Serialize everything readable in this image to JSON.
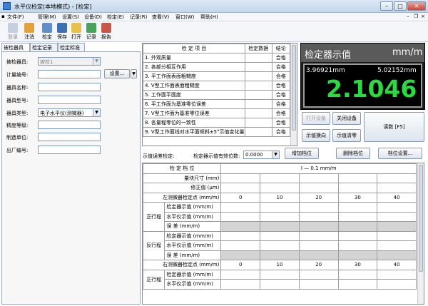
{
  "window": {
    "title": "水平仪检定(本地模式) - [检定]"
  },
  "menu": [
    "文件(F)",
    "管理(M)",
    "设置(S)",
    "设备(D)",
    "检定(E)",
    "记录(R)",
    "查看(V)",
    "窗口(W)",
    "帮助(H)"
  ],
  "toolbar": [
    {
      "label": "登录",
      "icon": "login-icon",
      "disabled": true
    },
    {
      "label": "注消",
      "icon": "logout-icon",
      "disabled": false
    },
    {
      "label": "检定",
      "icon": "verify-icon",
      "disabled": false
    },
    {
      "label": "保存",
      "icon": "save-icon",
      "disabled": false
    },
    {
      "label": "打开",
      "icon": "open-folder-icon",
      "disabled": false
    },
    {
      "label": "记录",
      "icon": "record-icon",
      "disabled": false
    },
    {
      "label": "报告",
      "icon": "report-icon",
      "disabled": false
    }
  ],
  "left_tabs": [
    "被检器具",
    "检定记录",
    "检定标准"
  ],
  "form": {
    "instrument_label": "被检器具:",
    "instrument_value": "被检1",
    "meter_no_label": "计量编号:",
    "settings_button": "设置...",
    "name_label": "器具名称:",
    "model_label": "器具型号:",
    "type_label": "器具类型:",
    "type_value": "电子水平仪(测微器)",
    "accuracy_label": "精度等级:",
    "maker_label": "制造单位:",
    "serial_label": "出厂编号:"
  },
  "check_table": {
    "headers": [
      "检 定 项 目",
      "检定数据",
      "结论"
    ],
    "rows": [
      {
        "item": "1. 外观质量",
        "result": "合格"
      },
      {
        "item": "2. 各部分相互作用",
        "result": "合格"
      },
      {
        "item": "3. 平工作面表面粗糙度",
        "result": "合格"
      },
      {
        "item": "4. V型工作面表面粗糙度",
        "result": "合格"
      },
      {
        "item": "5. 工作面平面度",
        "result": "合格"
      },
      {
        "item": "6. 平工作面为基准零位误差",
        "result": "合格"
      },
      {
        "item": "7. V型工作面为基准零位误差",
        "result": "合格"
      },
      {
        "item": "8. 各量程零位的一致性",
        "result": "合格"
      },
      {
        "item": "9. V型工作面线对水平面倾斜±5°示值变化量",
        "result": "合格"
      }
    ]
  },
  "display": {
    "title": "检定器示值",
    "unit": "mm/m",
    "left_reading": "3.96921mm",
    "right_reading": "5.02152mm",
    "main_value": "2.1046"
  },
  "device_buttons": {
    "open_device": "打开设备",
    "close_device": "关闭设备",
    "value_toggle": "示值换向",
    "value_zero": "示值清零",
    "read": "读数 [F5]"
  },
  "error_row": {
    "label": "示值误差检定:",
    "digits_label": "检定器示值有效位数:",
    "digits_value": "0.0000",
    "add_level": "增加档位",
    "delete_level": "删除档位",
    "level_settings": "档位设置..."
  },
  "grid": {
    "level_label": "检 定 档 位",
    "level_value": "I — 0.1 mm/m",
    "block_label": "量块尺寸 (mm)",
    "correction_label": "修正值 (μm)",
    "left_points_label": "左测微器检定点 (mm/m)",
    "right_points_label": "右测微器检定点 (mm/m)",
    "points": [
      "0",
      "10",
      "20",
      "30",
      "40"
    ],
    "forward_label": "正行程",
    "reverse_label": "反行程",
    "meter_reading": "检定器示值 (mm/m)",
    "level_reading": "水平仪示值 (mm/m)",
    "error_label": "误 差 (mm/m)"
  },
  "colors": {
    "display_digits": "#2bd940",
    "display_text": "#ffffff",
    "display_bg": "#000000"
  }
}
